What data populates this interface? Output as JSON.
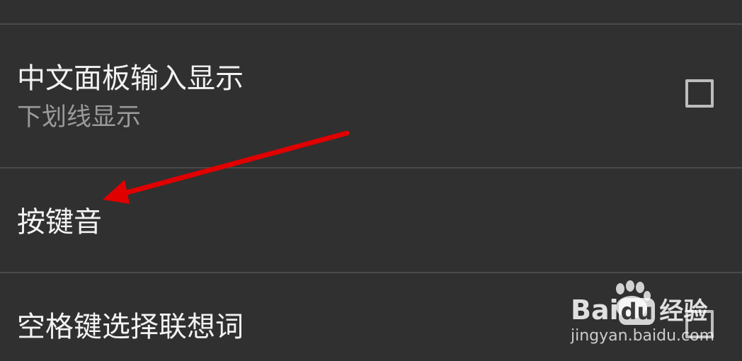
{
  "settings": {
    "items": [
      {
        "title": "中文面板输入显示",
        "summary": "下划线显示",
        "checked": false
      },
      {
        "title": "按键音"
      },
      {
        "title": "空格键选择联想词",
        "checked": false
      }
    ]
  },
  "watermark": {
    "brand_left": "Bai",
    "brand_right": "du",
    "brand_cn": "经验",
    "url": "jingyan.baidu.com"
  },
  "colors": {
    "background": "#303030",
    "divider": "#4a4a4a",
    "title_text": "#f2f2f2",
    "summary_text": "#9a9a9a",
    "checkbox_border": "#bdbdbd",
    "annotation_arrow": "#e00000"
  },
  "icons": {
    "annotation": "red-arrow-icon",
    "checkbox": "checkbox-unchecked-icon"
  }
}
